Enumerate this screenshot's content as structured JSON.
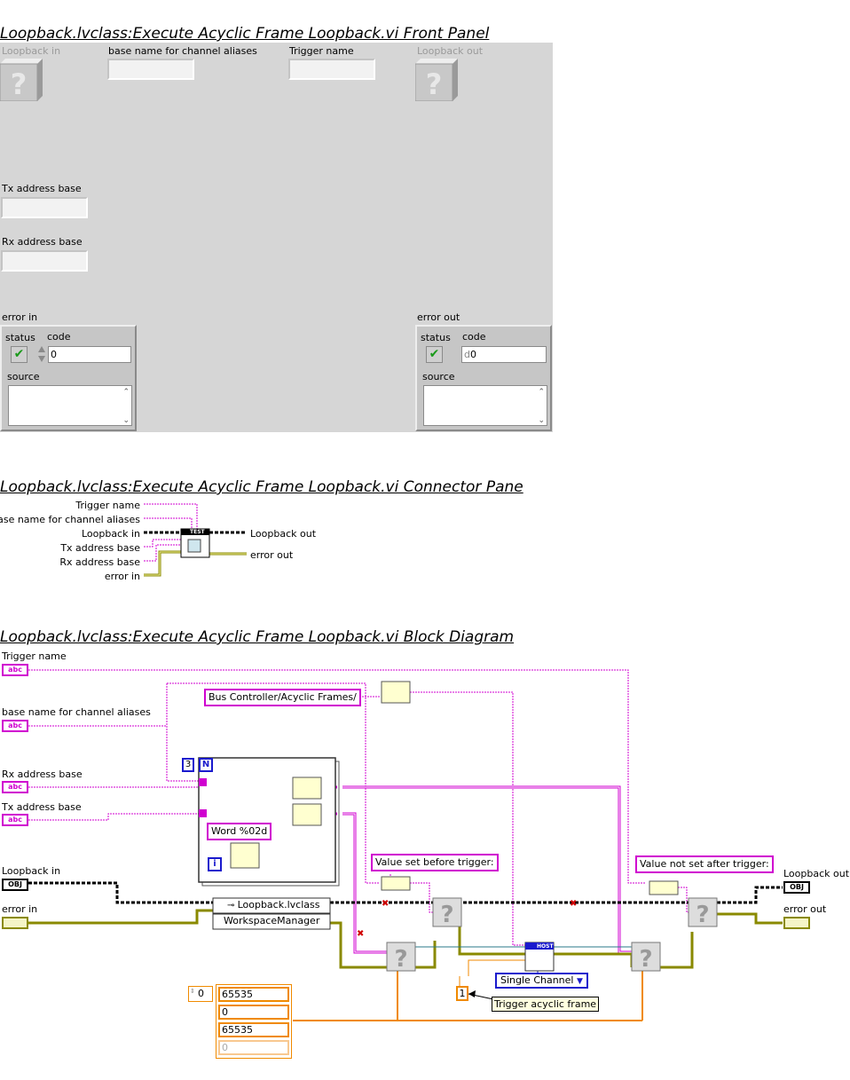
{
  "front_panel": {
    "title": "Loopback.lvclass:Execute Acyclic Frame Loopback.vi Front Panel",
    "loopback_in_label": "Loopback in",
    "base_name_label": "base name for channel aliases",
    "trigger_name_label": "Trigger name",
    "loopback_out_label": "Loopback out",
    "tx_address_label": "Tx address base",
    "rx_address_label": "Rx address base",
    "error_in": {
      "label": "error in",
      "status_label": "status",
      "code_label": "code",
      "code_value": "0",
      "source_label": "source"
    },
    "error_out": {
      "label": "error out",
      "status_label": "status",
      "code_label": "code",
      "code_value": "0",
      "code_prefix": "d",
      "source_label": "source"
    }
  },
  "connector_pane": {
    "title": "Loopback.lvclass:Execute Acyclic Frame Loopback.vi Connector Pane",
    "inputs": [
      "Trigger name",
      "base name for channel aliases",
      "Loopback in",
      "Tx address base",
      "Rx address base",
      "error in"
    ],
    "outputs": [
      "Loopback out",
      "error out"
    ],
    "icon_text": "TEST"
  },
  "block_diagram": {
    "title": "Loopback.lvclass:Execute Acyclic Frame Loopback.vi Block Diagram",
    "terminals": {
      "trigger_name": "Trigger name",
      "base_name": "base name for channel aliases",
      "rx_address": "Rx address base",
      "tx_address": "Tx address base",
      "loopback_in": "Loopback in",
      "error_in": "error in",
      "loopback_out": "Loopback out",
      "error_out": "error out"
    },
    "type_tags": {
      "string": "abc",
      "object": "OBJ"
    },
    "constants": {
      "bus_controller_path": "Bus Controller/Acyclic Frames/",
      "word_format": "Word %02d",
      "value_set_before": "Value set before trigger:",
      "value_not_set_after": "Value not set after trigger:",
      "loop_count": "3",
      "loop_n": "N",
      "loop_i": "i",
      "single_channel": "Single Channel",
      "one": "1",
      "trigger_comment": "Trigger acyclic frame",
      "class_name": "Loopback.lvclass",
      "property": "WorkspaceManager",
      "host_label": "HOST",
      "array_index": "0",
      "array_values": [
        "65535",
        "0",
        "65535",
        "0"
      ]
    }
  }
}
